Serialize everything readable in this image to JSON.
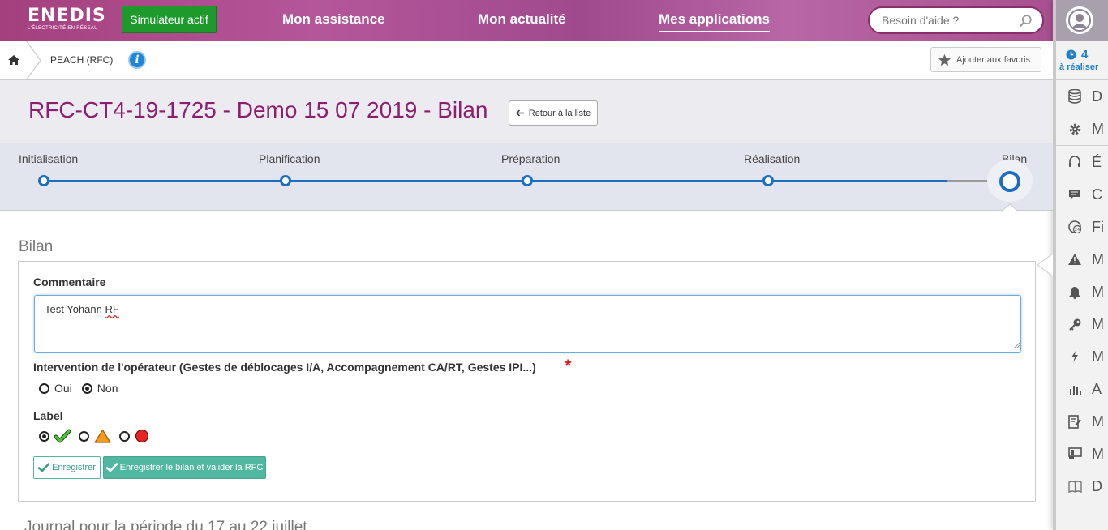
{
  "header": {
    "logo_word": "ENEDIS",
    "logo_tagline": "L'ÉLECTRICITÉ EN RÉSEAU",
    "simulator_label": "Simulateur actif",
    "nav": [
      "Mon assistance",
      "Mon actualité",
      "Mes applications"
    ],
    "active_nav": "Mes applications",
    "search_placeholder": "Besoin d'aide ?"
  },
  "breadcrumb": {
    "app": "PEACH (RFC)",
    "favorites_label": "Ajouter aux favoris"
  },
  "page": {
    "title": "RFC-CT4-19-1725 - Demo 15 07 2019 - Bilan",
    "back_label": "Retour à la liste"
  },
  "stepper": {
    "steps": [
      "Initialisation",
      "Planification",
      "Préparation",
      "Réalisation",
      "Bilan"
    ],
    "current": "Bilan"
  },
  "bilan": {
    "section_title": "Bilan",
    "comment_label": "Commentaire",
    "comment_value": "Test Yohann RF",
    "intervention_label": "Intervention de l'opérateur (Gestes de déblocages I/A, Accompagnement CA/RT, Gestes IPI...)",
    "required_marker": "*",
    "oui_label": "Oui",
    "non_label": "Non",
    "intervention_value": "Non",
    "label_title": "Label",
    "label_selected": "green",
    "save_label": "Enregistrer",
    "validate_label": "Enregistrer le bilan et valider la RFC"
  },
  "journal_title": "Journal pour la période du 17 au 22 juillet",
  "sidebar": {
    "todo_count": "4",
    "todo_label": "à réaliser",
    "items": [
      {
        "icon": "database-icon",
        "label": "D"
      },
      {
        "icon": "gear-icon",
        "label": "M"
      },
      {
        "icon": "headset-icon",
        "label": "É"
      },
      {
        "icon": "chat-icon",
        "label": "C"
      },
      {
        "icon": "clock-24-icon",
        "label": "Fi"
      },
      {
        "icon": "warning-icon",
        "label": "M"
      },
      {
        "icon": "bell-icon",
        "label": "M"
      },
      {
        "icon": "key-icon",
        "label": "M"
      },
      {
        "icon": "lightning-icon",
        "label": "M"
      },
      {
        "icon": "bar-chart-icon",
        "label": "A"
      },
      {
        "icon": "edit-doc-icon",
        "label": "M"
      },
      {
        "icon": "terminal-icon",
        "label": "M"
      },
      {
        "icon": "book-icon",
        "label": "D"
      }
    ]
  },
  "colors": {
    "brand": "#9c2a7a",
    "stepper_blue": "#1b6ec2",
    "success": "#52b7a0",
    "required": "#d9201f"
  }
}
